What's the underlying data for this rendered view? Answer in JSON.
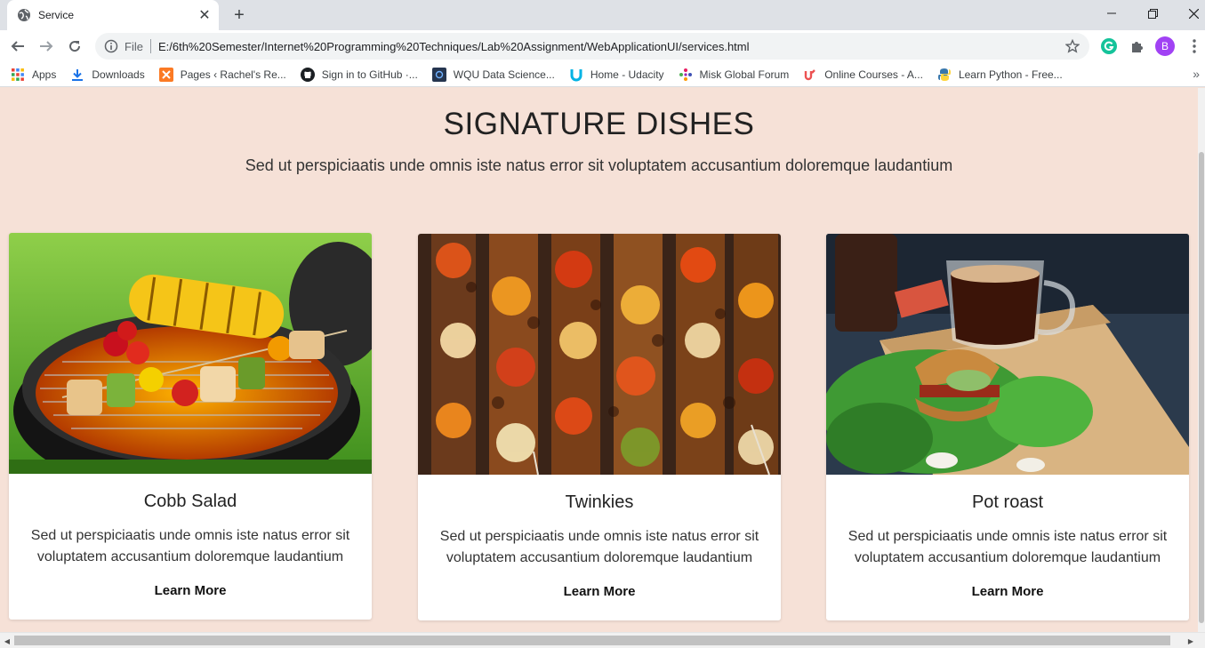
{
  "browser": {
    "tab_title": "Service",
    "new_tab": "+",
    "url_scheme": "File",
    "url": "E:/6th%20Semester/Internet%20Programming%20Techniques/Lab%20Assignment/WebApplicationUI/services.html",
    "profile_initial": "B",
    "accent_color": "#a142f4"
  },
  "bookmarks": [
    {
      "label": "Apps",
      "icon": "apps-grid-icon"
    },
    {
      "label": "Downloads",
      "icon": "download-icon"
    },
    {
      "label": "Pages ‹ Rachel's Re...",
      "icon": "xampp-icon"
    },
    {
      "label": "Sign in to GitHub ·...",
      "icon": "github-icon"
    },
    {
      "label": "WQU Data Science...",
      "icon": "wqu-icon"
    },
    {
      "label": "Home - Udacity",
      "icon": "udacity-icon"
    },
    {
      "label": "Misk Global Forum",
      "icon": "misk-icon"
    },
    {
      "label": "Online Courses - A...",
      "icon": "udemy-icon"
    },
    {
      "label": "Learn Python - Free...",
      "icon": "python-icon"
    }
  ],
  "page": {
    "heading": "SIGNATURE DISHES",
    "subheading": "Sed ut perspiciaatis unde omnis iste natus error sit voluptatem accusantium doloremque laudantium",
    "background_color": "#f6e1d7",
    "cards": [
      {
        "title": "Cobb Salad",
        "text": "Sed ut perspiciaatis unde omnis iste natus error sit voluptatem accusantium doloremque laudantium",
        "link": "Learn More",
        "image": "grilled-skewers-photo"
      },
      {
        "title": "Twinkies",
        "text": "Sed ut perspiciaatis unde omnis iste natus error sit voluptatem accusantium doloremque laudantium",
        "link": "Learn More",
        "image": "kebab-skewers-photo"
      },
      {
        "title": "Pot roast",
        "text": "Sed ut perspiciaatis unde omnis iste natus error sit voluptatem accusantium doloremque laudantium",
        "link": "Learn More",
        "image": "sandwich-coffee-photo"
      }
    ]
  }
}
